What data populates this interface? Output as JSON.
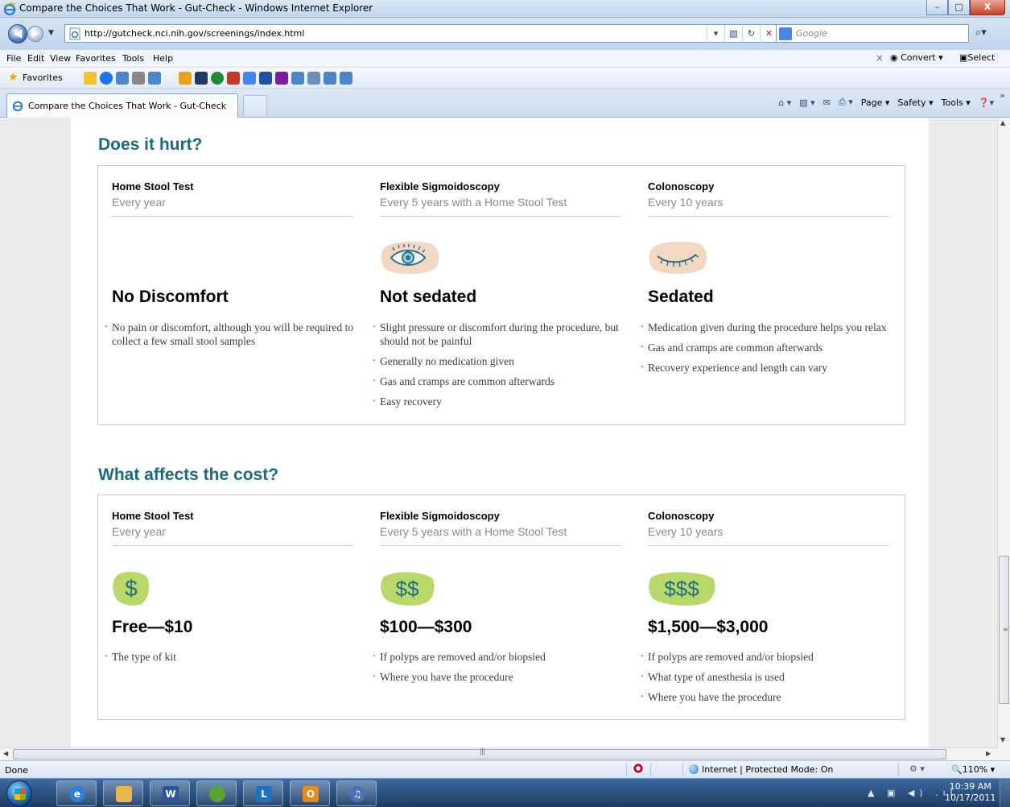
{
  "window": {
    "title": "Compare the Choices That Work - Gut-Check - Windows Internet Explorer",
    "minimize": "–",
    "maximize": "□",
    "close": "X"
  },
  "address": {
    "url": "http://gutcheck.nci.nih.gov/screenings/index.html",
    "search_engine": "Google"
  },
  "menu": {
    "items": [
      "File",
      "Edit",
      "View",
      "Favorites",
      "Tools",
      "Help"
    ],
    "convert": "Convert",
    "select": "Select"
  },
  "favorites": {
    "label": "Favorites"
  },
  "tab": {
    "label": "Compare the Choices That Work - Gut-Check"
  },
  "commandbar": {
    "page": "Page",
    "safety": "Safety",
    "tools": "Tools"
  },
  "hurt": {
    "title": "Does it hurt?",
    "columns": [
      {
        "name": "Home Stool Test",
        "freq": "Every year",
        "heading": "No Discomfort",
        "icon": "none",
        "bullets": [
          "No pain or discomfort, although you will be required to collect a few small stool samples"
        ]
      },
      {
        "name": "Flexible Sigmoidoscopy",
        "freq": "Every 5 years with a Home Stool Test",
        "heading": "Not sedated",
        "icon": "open-eye-icon",
        "bullets": [
          "Slight pressure or discomfort during the procedure, but should not be painful",
          "Generally no medication given",
          "Gas and cramps are common afterwards",
          "Easy recovery"
        ]
      },
      {
        "name": "Colonoscopy",
        "freq": "Every 10 years",
        "heading": "Sedated",
        "icon": "closed-eye-icon",
        "bullets": [
          "Medication given during the procedure helps you relax",
          "Gas and cramps are common afterwards",
          "Recovery experience and length can vary"
        ]
      }
    ]
  },
  "cost": {
    "title": "What affects the cost?",
    "columns": [
      {
        "name": "Home Stool Test",
        "freq": "Every year",
        "symbol": "$",
        "heading": "Free—$10",
        "bullets": [
          "The type of kit"
        ]
      },
      {
        "name": "Flexible Sigmoidoscopy",
        "freq": "Every 5 years with a Home Stool Test",
        "symbol": "$$",
        "heading": "$100—$300",
        "bullets": [
          "If polyps are removed and/or biopsied",
          "Where you have the procedure"
        ]
      },
      {
        "name": "Colonoscopy",
        "freq": "Every 10 years",
        "symbol": "$$$",
        "heading": "$1,500—$3,000",
        "bullets": [
          "If polyps are removed and/or biopsied",
          "What type of anesthesia is used",
          "Where you have the procedure"
        ]
      }
    ]
  },
  "status": {
    "text": "Done",
    "zone": "Internet | Protected Mode: On",
    "zoom": "110%"
  },
  "clock": {
    "time": "10:39 AM",
    "date": "10/17/2011"
  },
  "colors": {
    "accent": "#1c6a82",
    "money_green": "#b9d86a",
    "eye_skin": "#f2d7c2"
  }
}
